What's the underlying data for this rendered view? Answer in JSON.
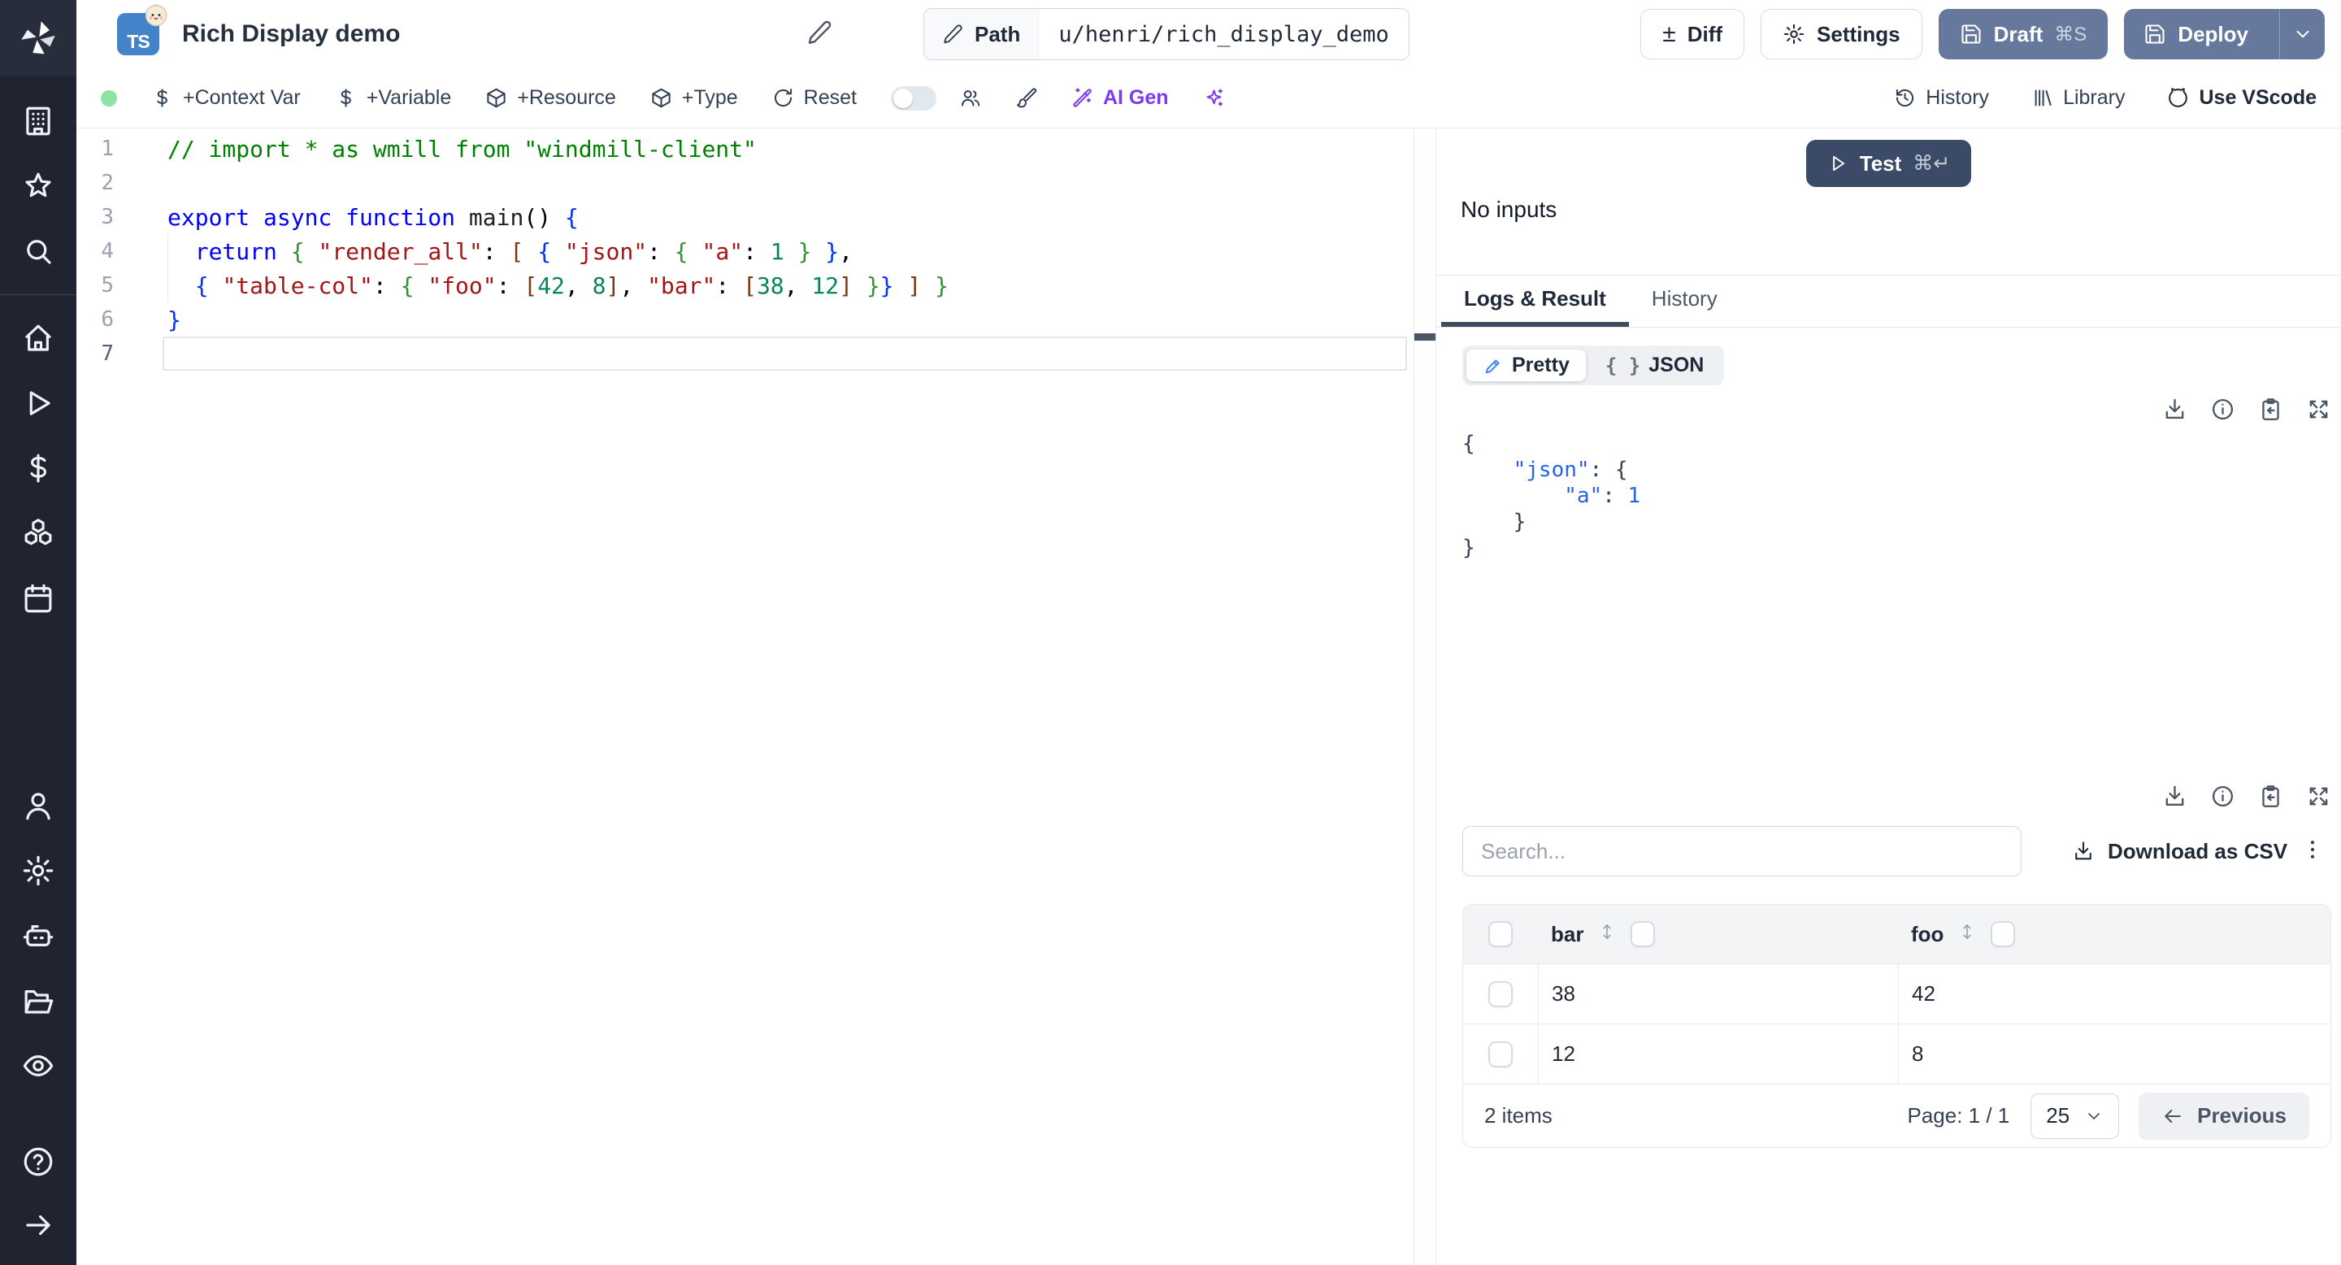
{
  "window": {
    "title": "Rich Display demo",
    "language_badge": "TS"
  },
  "topbar": {
    "path_label": "Path",
    "path_value": "u/henri/rich_display_demo",
    "diff_label": "Diff",
    "settings_label": "Settings",
    "draft_label": "Draft",
    "draft_shortcut": "⌘S",
    "deploy_label": "Deploy"
  },
  "toolbar": {
    "context_var": "+Context Var",
    "variable": "+Variable",
    "resource": "+Resource",
    "type": "+Type",
    "reset": "Reset",
    "ai_gen": "AI Gen",
    "history": "History",
    "library": "Library",
    "vscode": "Use VScode"
  },
  "editor": {
    "current_line": 7,
    "lines": [
      [
        [
          "// import * as wmill from \"windmill-client\"",
          "cm"
        ]
      ],
      [],
      [
        [
          "export async function ",
          "kw"
        ],
        [
          "main",
          "fn"
        ],
        [
          "()",
          "pl"
        ],
        [
          " ",
          ""
        ],
        [
          "{",
          "b1"
        ]
      ],
      [
        [
          "  ",
          ""
        ],
        [
          "return",
          "kw"
        ],
        [
          " ",
          ""
        ],
        [
          "{",
          "b2"
        ],
        [
          " ",
          ""
        ],
        [
          "\"render_all\"",
          "str"
        ],
        [
          ": ",
          "pl"
        ],
        [
          "[",
          "b3"
        ],
        [
          " ",
          ""
        ],
        [
          "{",
          "b1"
        ],
        [
          " ",
          ""
        ],
        [
          "\"json\"",
          "str"
        ],
        [
          ": ",
          "pl"
        ],
        [
          "{",
          "b2"
        ],
        [
          " ",
          ""
        ],
        [
          "\"a\"",
          "str"
        ],
        [
          ": ",
          "pl"
        ],
        [
          "1",
          "num"
        ],
        [
          " ",
          ""
        ],
        [
          "}",
          "b2"
        ],
        [
          " ",
          ""
        ],
        [
          "}",
          "b1"
        ],
        [
          ",",
          "pl"
        ]
      ],
      [
        [
          "  ",
          ""
        ],
        [
          "{",
          "b1"
        ],
        [
          " ",
          ""
        ],
        [
          "\"table-col\"",
          "str"
        ],
        [
          ": ",
          "pl"
        ],
        [
          "{",
          "b2"
        ],
        [
          " ",
          ""
        ],
        [
          "\"foo\"",
          "str"
        ],
        [
          ": ",
          "pl"
        ],
        [
          "[",
          "b3"
        ],
        [
          "42",
          "num"
        ],
        [
          ", ",
          "pl"
        ],
        [
          "8",
          "num"
        ],
        [
          "]",
          "b3"
        ],
        [
          ", ",
          "pl"
        ],
        [
          "\"bar\"",
          "str"
        ],
        [
          ": ",
          "pl"
        ],
        [
          "[",
          "b3"
        ],
        [
          "38",
          "num"
        ],
        [
          ", ",
          "pl"
        ],
        [
          "12",
          "num"
        ],
        [
          "]",
          "b3"
        ],
        [
          " ",
          ""
        ],
        [
          "}",
          "b2"
        ],
        [
          "}",
          "b1"
        ],
        [
          " ",
          ""
        ],
        [
          "]",
          "b3"
        ],
        [
          " ",
          ""
        ],
        [
          "}",
          "b2"
        ]
      ],
      [
        [
          "}",
          "b1"
        ]
      ],
      []
    ]
  },
  "runner": {
    "test_label": "Test",
    "test_shortcut": "⌘↵",
    "no_inputs": "No inputs",
    "tabs": [
      "Logs & Result",
      "History"
    ],
    "active_tab": "Logs & Result",
    "view_toggle": [
      "Pretty",
      "JSON"
    ],
    "active_view": "Pretty",
    "json_glyph": "{ }",
    "result_json_lines": [
      [
        [
          "{",
          "jb"
        ]
      ],
      [
        [
          "    ",
          ""
        ],
        [
          "\"json\"",
          "jk"
        ],
        [
          ": ",
          "jb"
        ],
        [
          "{",
          "jb"
        ]
      ],
      [
        [
          "        ",
          ""
        ],
        [
          "\"a\"",
          "jk"
        ],
        [
          ": ",
          "jb"
        ],
        [
          "1",
          "jn"
        ]
      ],
      [
        [
          "    ",
          ""
        ],
        [
          "}",
          "jb"
        ]
      ],
      [
        [
          "}",
          "jb"
        ]
      ]
    ],
    "search_placeholder": "Search...",
    "download_csv": "Download as CSV",
    "table": {
      "columns": [
        "bar",
        "foo"
      ],
      "rows": [
        [
          "38",
          "42"
        ],
        [
          "12",
          "8"
        ]
      ],
      "items_label": "2 items",
      "page_label": "Page: 1 / 1",
      "page_size": "25",
      "previous_label": "Previous"
    }
  },
  "icons": {
    "topbar": [
      "pencil-icon",
      "plus-minus-icon",
      "gear-icon",
      "save-icon",
      "chevron-down-icon"
    ],
    "toolbar": [
      "dollar-icon",
      "package-icon",
      "rotate-icon",
      "toggle-switch",
      "users-icon",
      "brush-icon",
      "wand-icon",
      "sparkles-icon",
      "history-icon",
      "library-icon",
      "vscode-icon"
    ],
    "sidebar": [
      "windmill-logo",
      "building-icon",
      "star-icon",
      "search-icon",
      "home-icon",
      "play-icon",
      "dollar-icon",
      "boxes-icon",
      "calendar-icon",
      "user-icon",
      "gear-icon",
      "bot-icon",
      "folder-icon",
      "eye-icon",
      "help-icon",
      "arrow-right-icon"
    ],
    "result": [
      "download-icon",
      "info-icon",
      "clipboard-copy-icon",
      "expand-icon",
      "kebab-icon",
      "sort-icon",
      "arrow-left-icon"
    ]
  },
  "colors": {
    "sidebar_bg": "#1f2430",
    "slate_button": "#66799c",
    "test_button": "#3b4a66",
    "ai_accent": "#7c3aed",
    "status_green": "#8be3a4",
    "ts_badge": "#4283c9",
    "json_key_blue": "#2563eb",
    "tab_underline": "#414b5e"
  }
}
